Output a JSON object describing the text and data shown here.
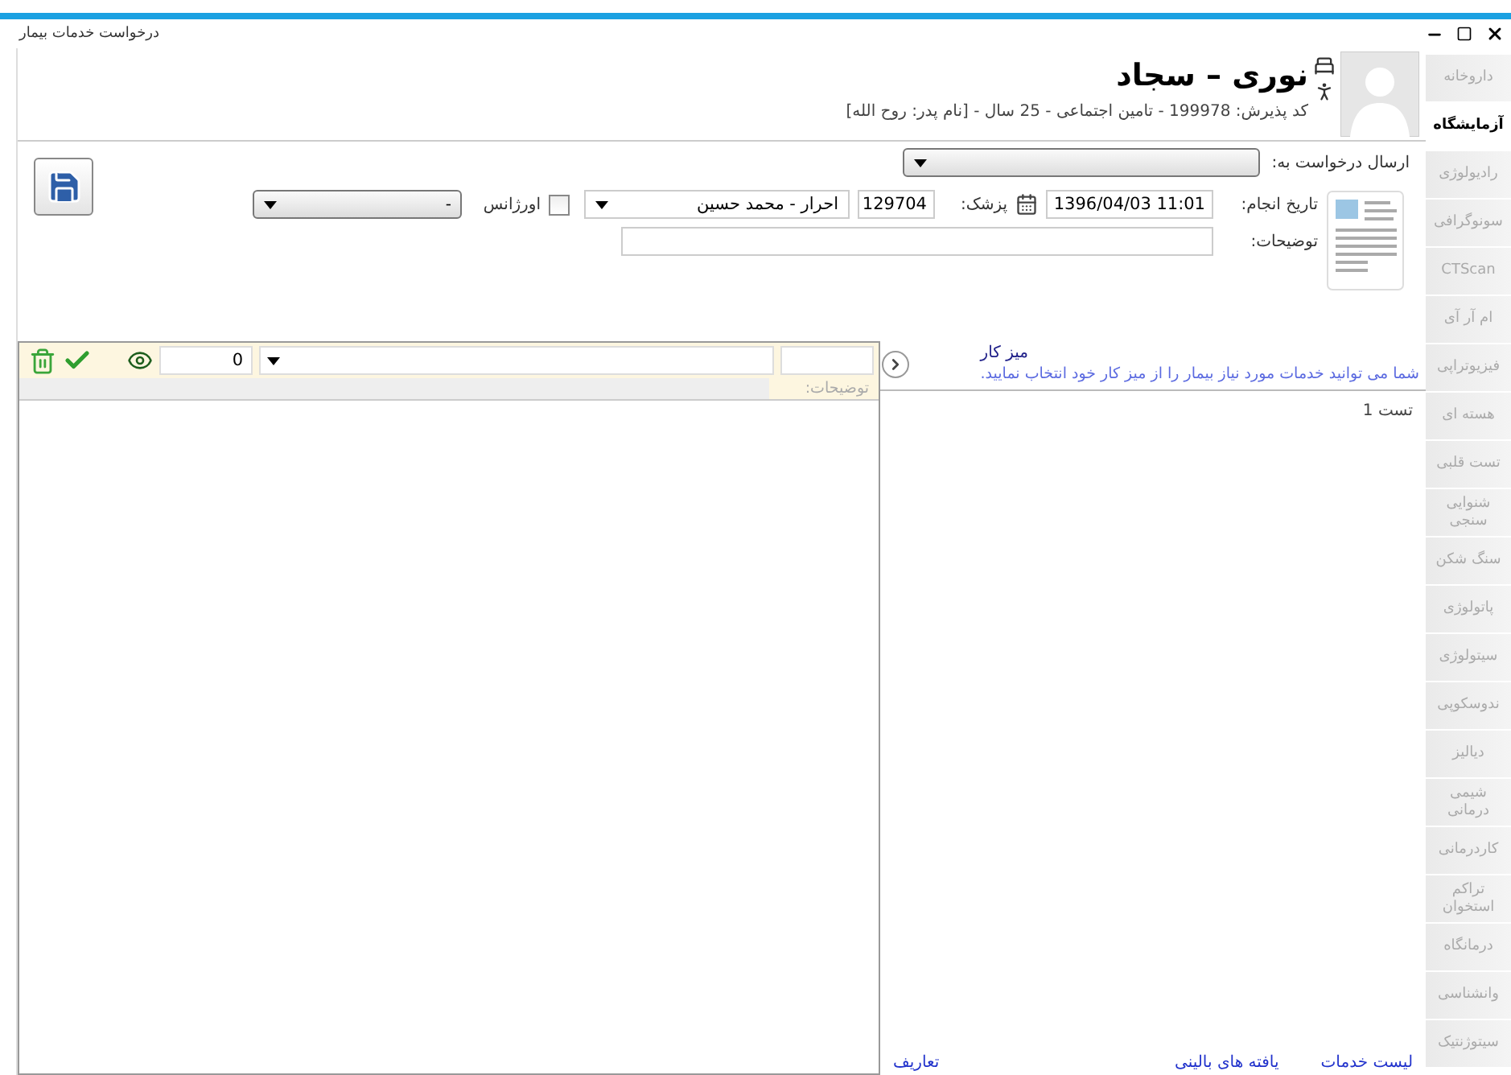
{
  "window": {
    "title": "درخواست خدمات بیمار"
  },
  "patient": {
    "name": "نوری – سجاد",
    "details": "کد پذیرش: 199978 - تامین اجتماعی - 25 سال - [نام پدر: روح الله]"
  },
  "form": {
    "send_to": {
      "label": "ارسال درخواست به:"
    },
    "date": {
      "label": "تاریخ انجام:",
      "value": "1396/04/03 11:01"
    },
    "doctor": {
      "label": "پزشک:",
      "code": "129704",
      "name": "احرار - محمد حسین"
    },
    "emergency": {
      "label": "اورژانس",
      "checked": false
    },
    "extra_select": {
      "value": "-"
    },
    "notes": {
      "label": "توضیحات:"
    }
  },
  "order_panel": {
    "quantity": "0",
    "notes_label": "توضیحات:"
  },
  "workbench": {
    "title": "میز کار",
    "hint": "شما می توانید خدمات مورد نیاز بیمار را از میز کار خود انتخاب نمایید.",
    "items": [
      "تست 1"
    ]
  },
  "bottom_links": [
    "لیست خدمات",
    "یافته های بالینی",
    "تعاریف"
  ],
  "tabs": [
    {
      "label": "داروخانه",
      "selected": false
    },
    {
      "label": "آزمایشگاه",
      "selected": true
    },
    {
      "label": "رادیولوژی",
      "selected": false
    },
    {
      "label": "سونوگرافی",
      "selected": false
    },
    {
      "label": "CTScan",
      "selected": false
    },
    {
      "label": "ام آر آی",
      "selected": false
    },
    {
      "label": "فیزیوتراپی",
      "selected": false
    },
    {
      "label": "هسته ای",
      "selected": false
    },
    {
      "label": "تست قلبی",
      "selected": false
    },
    {
      "label": "شنوایی سنجی",
      "selected": false
    },
    {
      "label": "سنگ شکن",
      "selected": false
    },
    {
      "label": "پاتولوژی",
      "selected": false
    },
    {
      "label": "سیتولوژی",
      "selected": false
    },
    {
      "label": "ندوسکوپی",
      "selected": false
    },
    {
      "label": "دیالیز",
      "selected": false
    },
    {
      "label": "شیمی درمانی",
      "selected": false
    },
    {
      "label": "کاردرمانی",
      "selected": false
    },
    {
      "label": "تراکم استخوان",
      "selected": false
    },
    {
      "label": "درمانگاه",
      "selected": false
    },
    {
      "label": "وانشناسی",
      "selected": false
    },
    {
      "label": "سیتوژنتیک",
      "selected": false
    }
  ]
}
